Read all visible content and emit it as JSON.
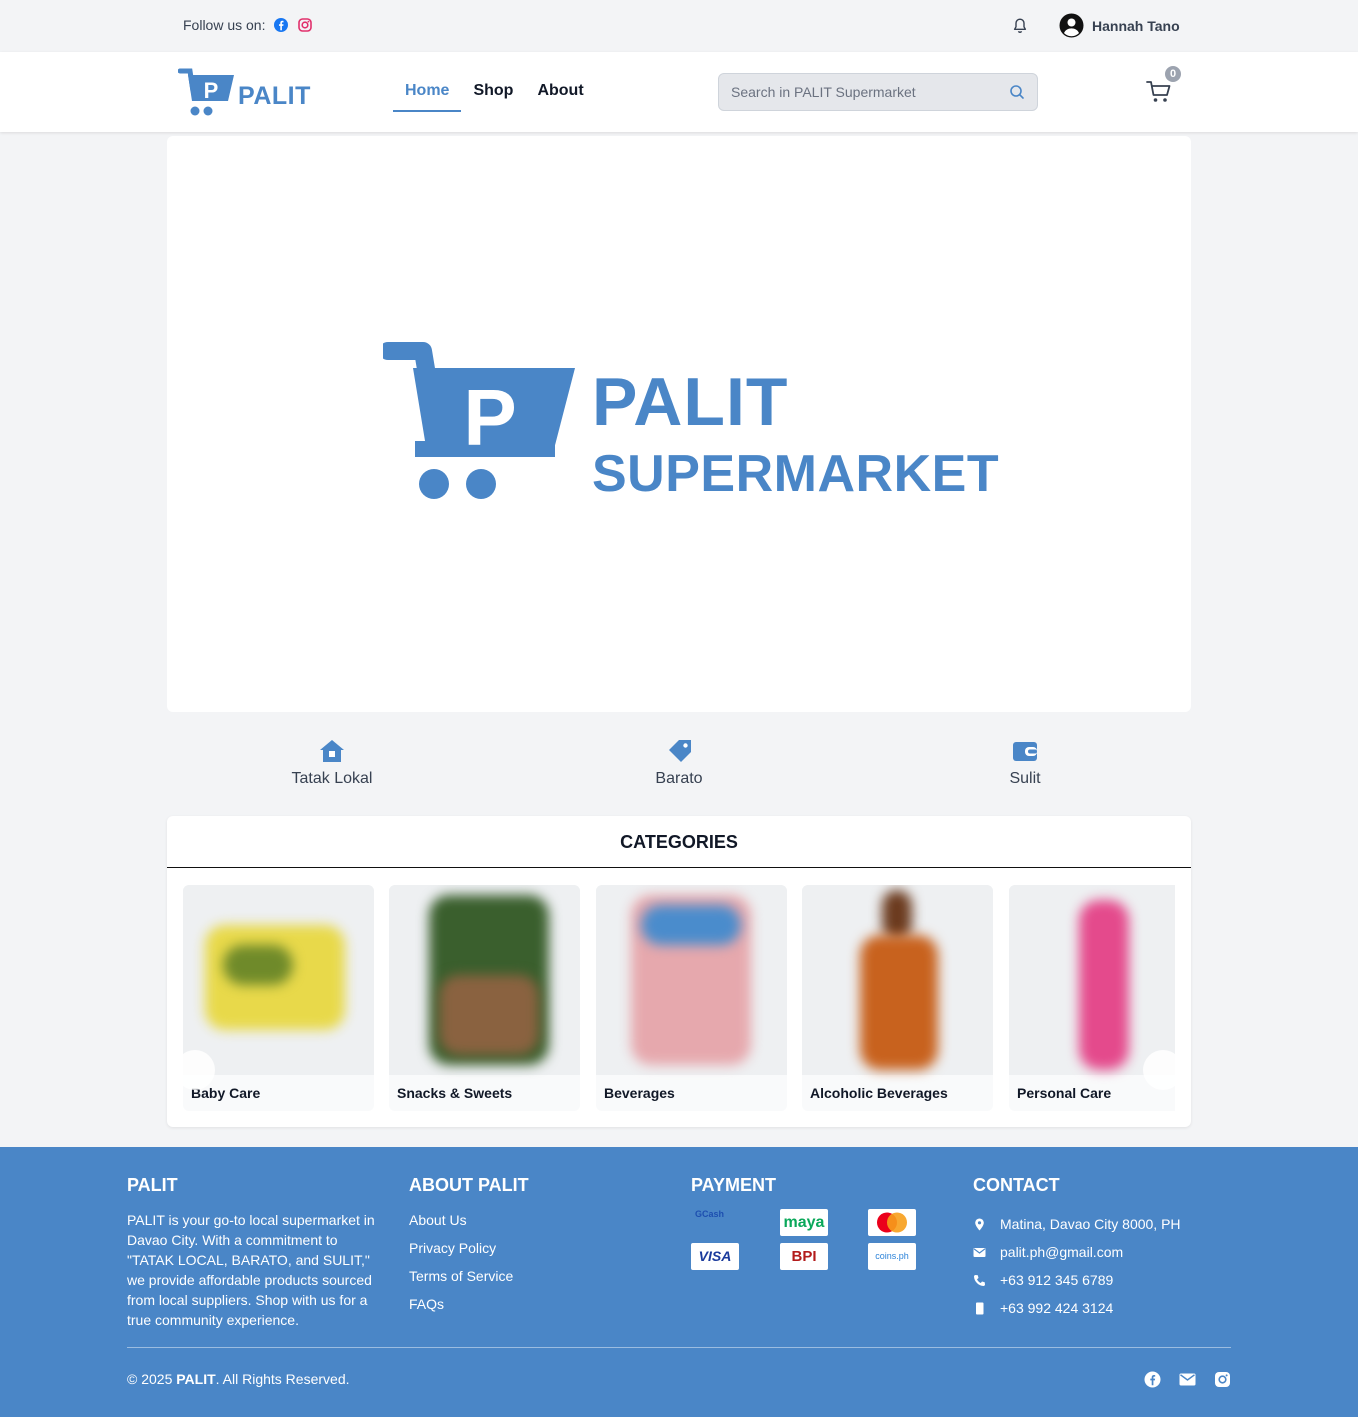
{
  "topbar": {
    "follow_label": "Follow us on:",
    "user_name": "Hannah Tano"
  },
  "navbar": {
    "brand": "PALIT",
    "nav": [
      "Home",
      "Shop",
      "About"
    ],
    "search_placeholder": "Search in PALIT Supermarket",
    "cart_count": "0"
  },
  "hero": {
    "brand_line1": "PALIT",
    "brand_line2": "SUPERMARKET"
  },
  "features": [
    {
      "label": "Tatak Lokal",
      "icon": "house-icon"
    },
    {
      "label": "Barato",
      "icon": "tag-icon"
    },
    {
      "label": "Sulit",
      "icon": "wallet-icon"
    }
  ],
  "categories": {
    "title": "CATEGORIES",
    "items": [
      {
        "name": "Baby Care"
      },
      {
        "name": "Snacks & Sweets"
      },
      {
        "name": "Beverages"
      },
      {
        "name": "Alcoholic Beverages"
      },
      {
        "name": "Personal Care"
      }
    ]
  },
  "footer": {
    "about": {
      "title": "PALIT",
      "text": "PALIT is your go-to local supermarket in Davao City. With a commitment to \"TATAK LOCAL, BARATO, and SULIT,\" we provide affordable products sourced from local suppliers. Shop with us for a true community experience."
    },
    "links": {
      "title": "ABOUT PALIT",
      "items": [
        "About Us",
        "Privacy Policy",
        "Terms of Service",
        "FAQs"
      ]
    },
    "payment": {
      "title": "PAYMENT",
      "methods": [
        "GCash",
        "maya",
        "Mastercard",
        "VISA",
        "BPI",
        "coins.ph"
      ]
    },
    "contact": {
      "title": "CONTACT",
      "address": "Matina, Davao City 8000, PH",
      "email": "palit.ph@gmail.com",
      "phone": "+63 912 345 6789",
      "mobile": "+63 992 424 3124"
    },
    "copyright_prefix": "© 2025 ",
    "copyright_brand": "PALIT",
    "copyright_suffix": ". All Rights Reserved."
  },
  "colors": {
    "brand": "#4a86c7",
    "background": "#f3f4f6",
    "facebook": "#1877f2",
    "instagram": "#e1306c"
  }
}
